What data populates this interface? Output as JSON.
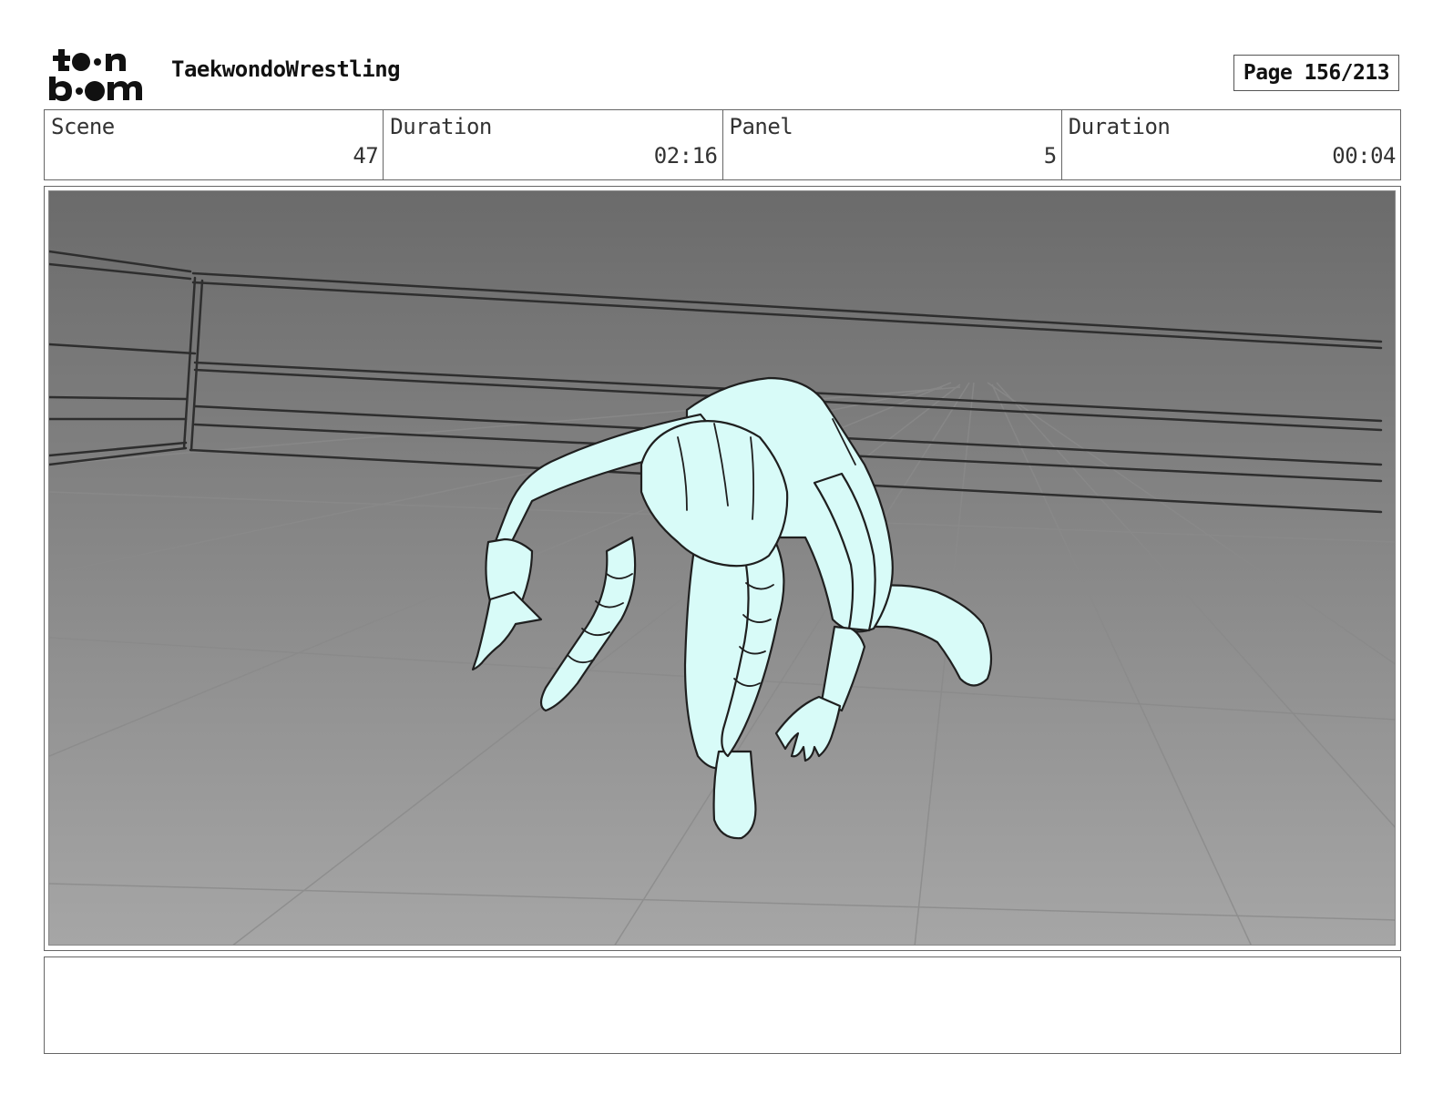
{
  "header": {
    "logo_icon": "toon-boom-logo",
    "project_title": "TaekwondoWrestling",
    "page_label": "Page 156/213"
  },
  "info": {
    "scene_label": "Scene",
    "scene_value": "47",
    "scene_duration_label": "Duration",
    "scene_duration_value": "02:16",
    "panel_label": "Panel",
    "panel_value": "5",
    "panel_duration_label": "Duration",
    "panel_duration_value": "00:04"
  },
  "panel": {
    "image_icon": "storyboard-sketch-wrestler-crouching-in-ring",
    "colors": {
      "bg_top": "#6b6b6b",
      "bg_bottom": "#a6a6a6",
      "figure_fill": "#d8fbf8",
      "lines": "#2a2a2a"
    }
  },
  "notes": {
    "text": ""
  }
}
